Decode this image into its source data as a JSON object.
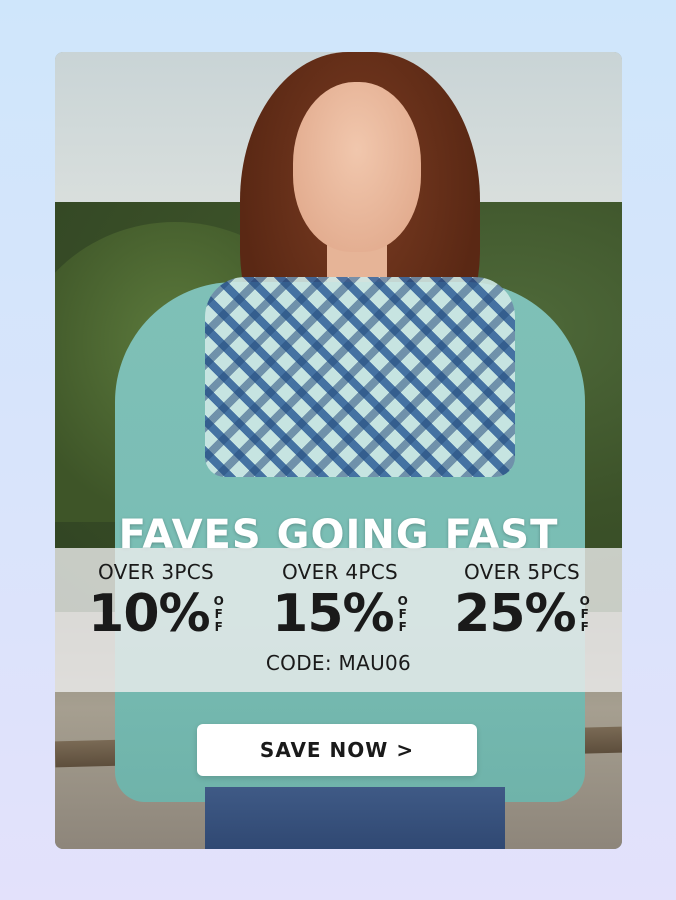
{
  "headline": "FAVES GOING FAST",
  "offers": [
    {
      "condition": "OVER 3PCS",
      "discount": "10%",
      "off_label": [
        "O",
        "F",
        "F"
      ]
    },
    {
      "condition": "OVER 4PCS",
      "discount": "15%",
      "off_label": [
        "O",
        "F",
        "F"
      ]
    },
    {
      "condition": "OVER 5PCS",
      "discount": "25%",
      "off_label": [
        "O",
        "F",
        "F"
      ]
    }
  ],
  "code_text": "CODE: MAU06",
  "cta_label": "SAVE NOW >"
}
